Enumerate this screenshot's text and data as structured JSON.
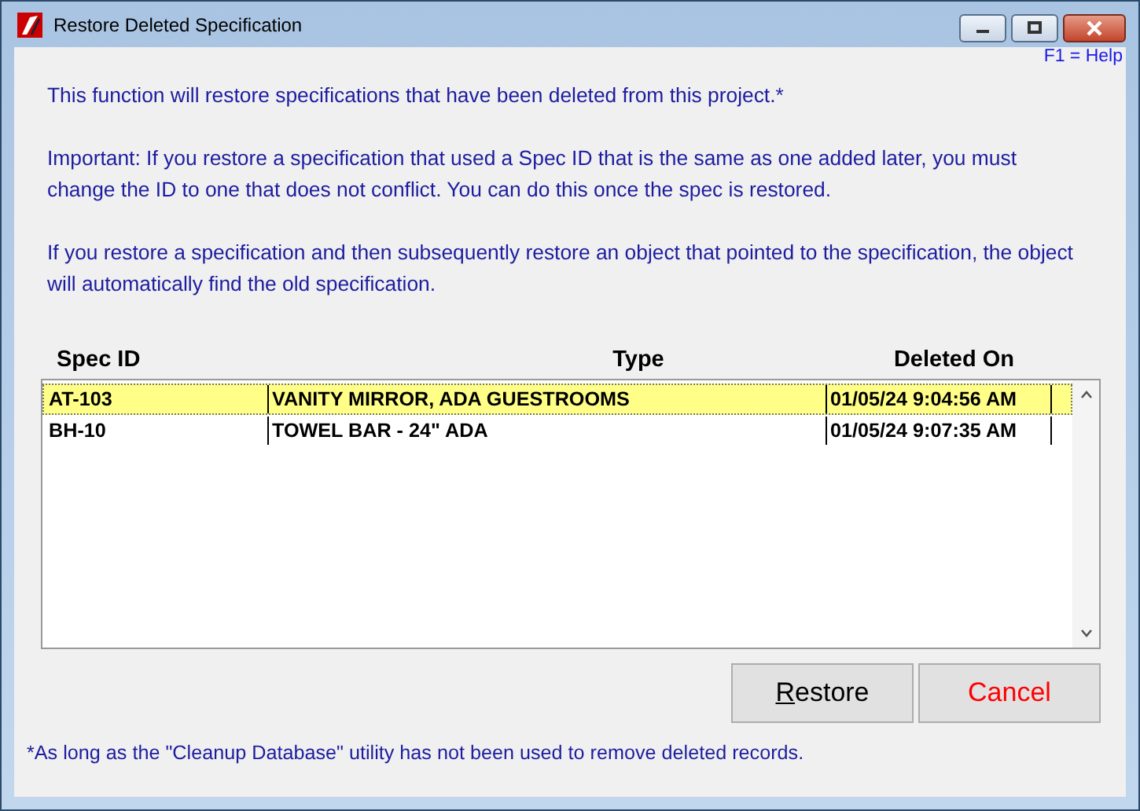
{
  "window": {
    "title": "Restore Deleted Specification"
  },
  "help": "F1 = Help",
  "paragraphs": [
    "This function will restore specifications that have been deleted from this project.*",
    "Important: If you restore a specification that used a Spec ID that is the same as one added later, you must change the ID to one that does not conflict. You can do this once the spec is restored.",
    "If you restore a specification and then subsequently restore an object that pointed to the specification, the object will automatically find the old specification."
  ],
  "table": {
    "columns": [
      "Spec ID",
      "Type",
      "Deleted On"
    ],
    "rows": [
      {
        "cells": [
          "AT-103",
          "VANITY MIRROR, ADA GUESTROOMS",
          "01/05/24 9:04:56 AM"
        ],
        "selected": true
      },
      {
        "cells": [
          "BH-10",
          "TOWEL BAR - 24\" ADA",
          "01/05/24 9:07:35 AM"
        ],
        "selected": false
      }
    ]
  },
  "buttons": [
    {
      "label": "Restore",
      "kind": "default"
    },
    {
      "label": "Cancel",
      "kind": "cancel"
    }
  ],
  "footnote": "*As long as the \"Cleanup Database\" utility has not been used to remove deleted records."
}
